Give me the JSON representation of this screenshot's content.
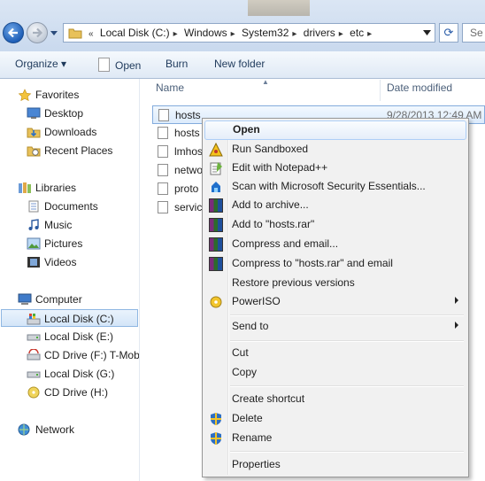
{
  "address": {
    "crumbs": [
      "Local Disk (C:)",
      "Windows",
      "System32",
      "drivers",
      "etc"
    ],
    "overflow_glyph": "«",
    "search_text": "Se"
  },
  "toolbar": {
    "organize": "Organize ▾",
    "open": "Open",
    "burn": "Burn",
    "new_folder": "New folder"
  },
  "nav": {
    "favorites": "Favorites",
    "desktop": "Desktop",
    "downloads": "Downloads",
    "recent": "Recent Places",
    "libraries": "Libraries",
    "documents": "Documents",
    "music": "Music",
    "pictures": "Pictures",
    "videos": "Videos",
    "computer": "Computer",
    "drive_c": "Local Disk (C:)",
    "drive_e": "Local Disk (E:)",
    "drive_f": "CD Drive (F:) T-Mob",
    "drive_g": "Local Disk (G:)",
    "drive_h": "CD Drive (H:)",
    "network": "Network"
  },
  "columns": {
    "name": "Name",
    "date": "Date modified"
  },
  "files": [
    {
      "name": "hosts",
      "date": "9/28/2013 12:49 AM"
    },
    {
      "name": "hosts"
    },
    {
      "name": "lmhos"
    },
    {
      "name": "netwo"
    },
    {
      "name": "proto"
    },
    {
      "name": "servic"
    }
  ],
  "menu": {
    "open": "Open",
    "sandbox": "Run Sandboxed",
    "notepad": "Edit with Notepad++",
    "scan": "Scan with Microsoft Security Essentials...",
    "add_archive": "Add to archive...",
    "add_rar": "Add to \"hosts.rar\"",
    "compress_email": "Compress and email...",
    "compress_rar_email": "Compress to \"hosts.rar\" and email",
    "restore": "Restore previous versions",
    "poweriso": "PowerISO",
    "send_to": "Send to",
    "cut": "Cut",
    "copy": "Copy",
    "shortcut": "Create shortcut",
    "delete": "Delete",
    "rename": "Rename",
    "properties": "Properties"
  },
  "colors": {
    "selection": "#dcebfc",
    "menu_bg": "#f1f1f1",
    "accent": "#1f5fb8"
  }
}
